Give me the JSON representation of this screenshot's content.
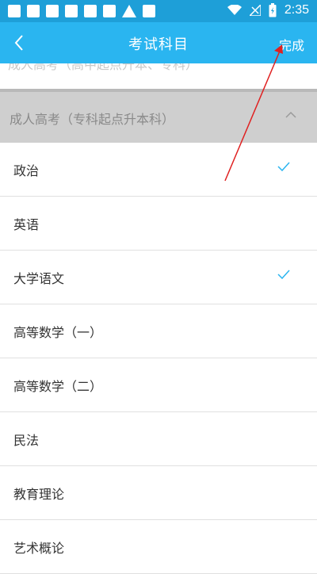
{
  "statusbar": {
    "time": "2:35",
    "icons": [
      "notification-icon",
      "notification-icon",
      "notification-icon",
      "notification-icon",
      "notification-icon",
      "notification-icon",
      "warning-icon",
      "notification-icon",
      "wifi-icon",
      "signal-icon",
      "battery-icon"
    ]
  },
  "appbar": {
    "title": "考试科目",
    "done_label": "完成",
    "background": "#2ab5f0"
  },
  "overlay_text": "成人高考（高中起点升本、专科）",
  "group": {
    "label": "成人高考（专科起点升本科）",
    "expanded": true
  },
  "subjects": [
    {
      "label": "政治",
      "checked": true
    },
    {
      "label": "英语",
      "checked": false
    },
    {
      "label": "大学语文",
      "checked": true
    },
    {
      "label": "高等数学（一）",
      "checked": false
    },
    {
      "label": "高等数学（二）",
      "checked": false
    },
    {
      "label": "民法",
      "checked": false
    },
    {
      "label": "教育理论",
      "checked": false
    },
    {
      "label": "艺术概论",
      "checked": false
    }
  ],
  "colors": {
    "statusbar": "#1e9fd8",
    "accent": "#2ab5f0",
    "check": "#2ab5f0",
    "annotation_arrow": "#e02020"
  }
}
